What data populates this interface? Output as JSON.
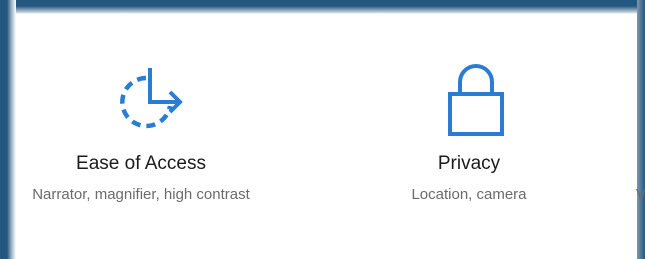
{
  "tiles": [
    {
      "title": "Ease of Access",
      "description": "Narrator, magnifier, high contrast",
      "icon": "ease-of-access-icon"
    },
    {
      "title": "Privacy",
      "description": "Location, camera",
      "icon": "lock-icon"
    },
    {
      "title": "",
      "description": "V",
      "icon": ""
    }
  ],
  "colors": {
    "accent": "#2b7cd3",
    "frame": "#24577f",
    "title_text": "#1b1b1b",
    "desc_text": "#6b6b6b"
  }
}
